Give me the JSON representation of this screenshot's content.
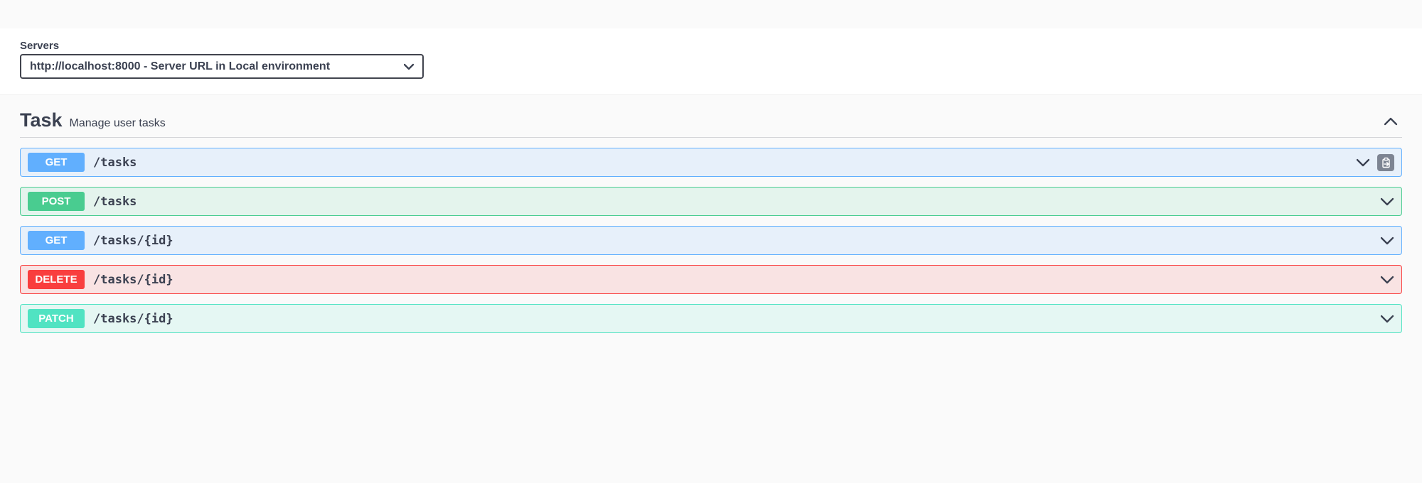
{
  "servers": {
    "label": "Servers",
    "selected": "http://localhost:8000 - Server URL in Local environment"
  },
  "tag": {
    "name": "Task",
    "description": "Manage user tasks",
    "expanded": true
  },
  "operations": [
    {
      "method": "GET",
      "path": "/tasks",
      "expanded": true,
      "showClipboard": true
    },
    {
      "method": "POST",
      "path": "/tasks",
      "expanded": false,
      "showClipboard": false
    },
    {
      "method": "GET",
      "path": "/tasks/{id}",
      "expanded": false,
      "showClipboard": false
    },
    {
      "method": "DELETE",
      "path": "/tasks/{id}",
      "expanded": false,
      "showClipboard": false
    },
    {
      "method": "PATCH",
      "path": "/tasks/{id}",
      "expanded": false,
      "showClipboard": false
    }
  ],
  "colors": {
    "get": "#61affe",
    "post": "#49cc90",
    "delete": "#f93e3e",
    "patch": "#50e3c2"
  }
}
